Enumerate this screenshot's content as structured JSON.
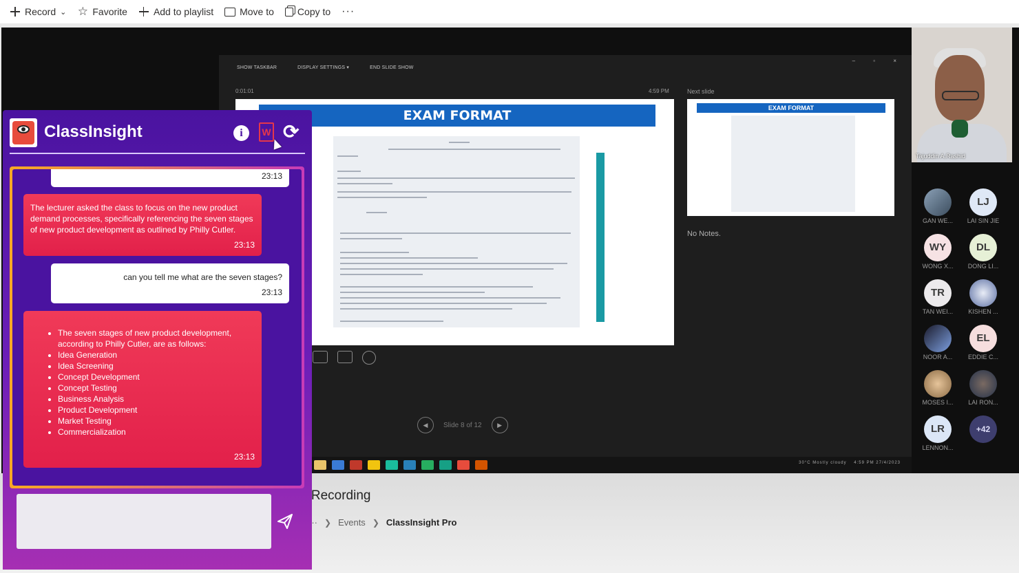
{
  "toolbar": {
    "record": "Record",
    "favorite": "Favorite",
    "add_to_playlist": "Add to playlist",
    "move_to": "Move to",
    "copy_to": "Copy to",
    "more": "···"
  },
  "presenter": {
    "show_taskbar": "SHOW TASKBAR",
    "display_settings": "DISPLAY SETTINGS ▾",
    "end_slide_show": "END SLIDE SHOW",
    "timer": "0:01:01",
    "clock": "4:59 PM",
    "next_slide_label": "Next slide",
    "slide_title": "EXAM FORMAT",
    "next_slide_title": "EXAM FORMAT",
    "notes": "No Notes.",
    "slide_counter": "Slide 8 of 12",
    "weather": "30°C Mostly cloudy",
    "taskbar_time": "4:59 PM",
    "taskbar_date": "27/4/2023"
  },
  "participants": {
    "speaker_name": "Tajuddin A.Rashid",
    "people": [
      {
        "initials": "",
        "name": "GAN WE..."
      },
      {
        "initials": "LJ",
        "name": "LAI SIN JIE"
      },
      {
        "initials": "WY",
        "name": "WONG X..."
      },
      {
        "initials": "DL",
        "name": "DONG LI..."
      },
      {
        "initials": "TR",
        "name": "TAN WEI..."
      },
      {
        "initials": "",
        "name": "KISHEN ..."
      },
      {
        "initials": "",
        "name": "NOOR A..."
      },
      {
        "initials": "EL",
        "name": "EDDIE C..."
      },
      {
        "initials": "",
        "name": "MOSES I..."
      },
      {
        "initials": "",
        "name": "LAI RON..."
      },
      {
        "initials": "LR",
        "name": "LENNON..."
      },
      {
        "initials": "+42",
        "name": ""
      }
    ]
  },
  "page": {
    "title_fragment": "g Recording",
    "breadcrumb_more": "···",
    "breadcrumb_events": "Events",
    "breadcrumb_current": "ClassInsight Pro"
  },
  "classinsight": {
    "title": "ClassInsight",
    "messages": [
      {
        "role": "user",
        "text": "",
        "time": "23:13"
      },
      {
        "role": "bot",
        "text": "The lecturer asked the class to focus on the new product demand processes, specifically referencing the seven stages of new product development as outlined by Philly Cutler.",
        "time": "23:13"
      },
      {
        "role": "user",
        "text": "can you tell me what are the seven stages?",
        "time": "23:13"
      },
      {
        "role": "bot",
        "intro": "The seven stages of new product development, according to Philly Cutler, are as follows:",
        "items": [
          "Idea Generation",
          "Idea Screening",
          "Concept Development",
          "Concept Testing",
          "Business Analysis",
          "Product Development",
          "Market Testing",
          "Commercialization"
        ],
        "time": "23:13"
      }
    ],
    "input_value": ""
  },
  "colors": {
    "panel_top": "#4a13a0",
    "panel_bottom": "#a62fb3",
    "bot_bubble": "#e8294d",
    "slide_title_bar": "#1565c0",
    "slide_accent_bar": "#1a9aa4"
  },
  "icons": [
    "plus-icon",
    "star-icon",
    "folder-icon",
    "copy-icon",
    "info-icon",
    "word-doc-icon",
    "refresh-icon",
    "send-icon"
  ]
}
